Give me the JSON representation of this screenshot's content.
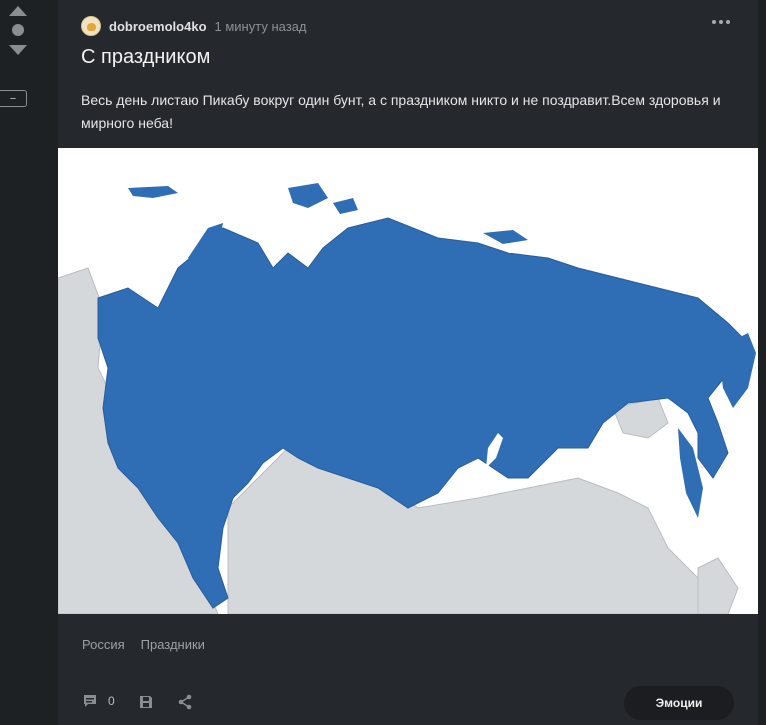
{
  "vote": {
    "minus_label": "−"
  },
  "post": {
    "author": "dobroemolo4ko",
    "time": "1 минуту назад",
    "title": "С праздником",
    "text": "Весь день листаю Пикабу вокруг один бунт, а с праздником никто и не поздравит.Всем здоровья и мирного неба!",
    "tags": [
      "Россия",
      "Праздники"
    ],
    "comments_count": "0",
    "emotions_label": "Эмоции"
  },
  "colors": {
    "background": "#1e2124",
    "card": "#25282c",
    "map_primary": "#2f6db5",
    "map_neighbors": "#d5d8db"
  },
  "icons": [
    "arrow-up-icon",
    "dot-icon",
    "arrow-down-icon",
    "more-icon",
    "comment-icon",
    "bookmark-icon",
    "share-icon"
  ]
}
